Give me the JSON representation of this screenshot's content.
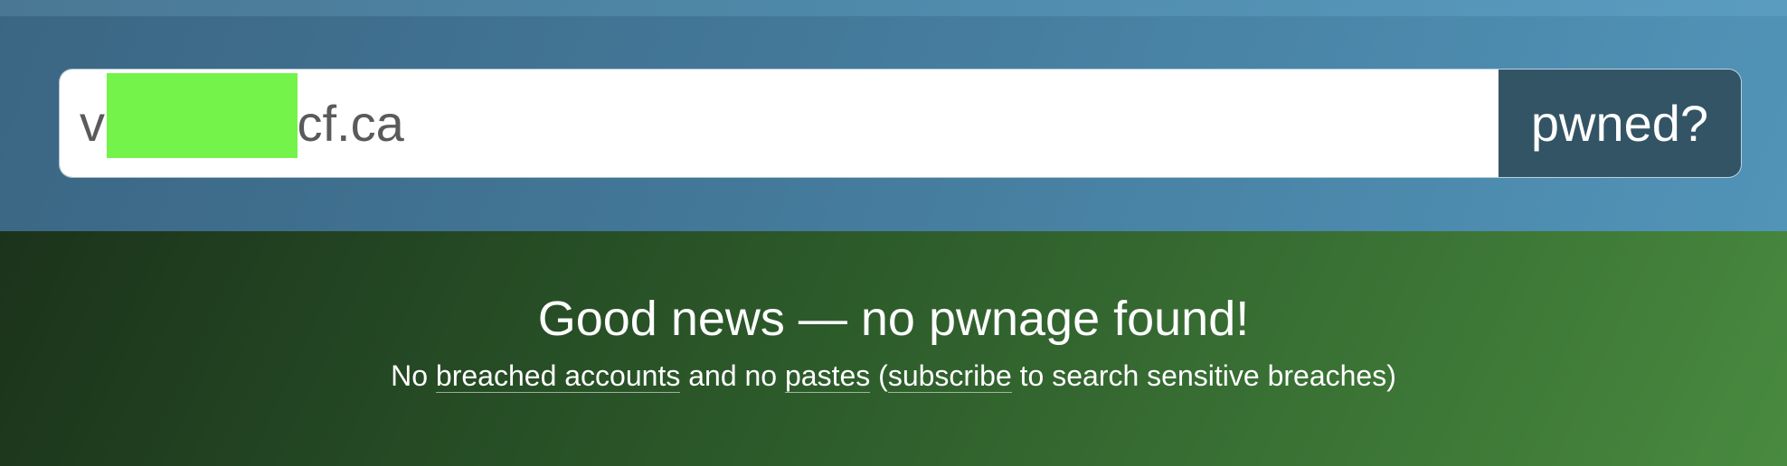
{
  "search": {
    "value": "v        @ncf.ca",
    "button_label": "pwned?"
  },
  "result": {
    "title": "Good news — no pwnage found!",
    "text_no": "No",
    "link_breached_accounts": "breached accounts",
    "text_and_no": "and no",
    "link_pastes": "pastes",
    "text_open_paren": "(",
    "link_subscribe": "subscribe",
    "text_tail": "to search sensitive breaches)"
  },
  "colors": {
    "header_band": "#44799a",
    "button_bg": "#335465",
    "result_band": "#2c5a2a",
    "redaction": "#74f44a"
  }
}
